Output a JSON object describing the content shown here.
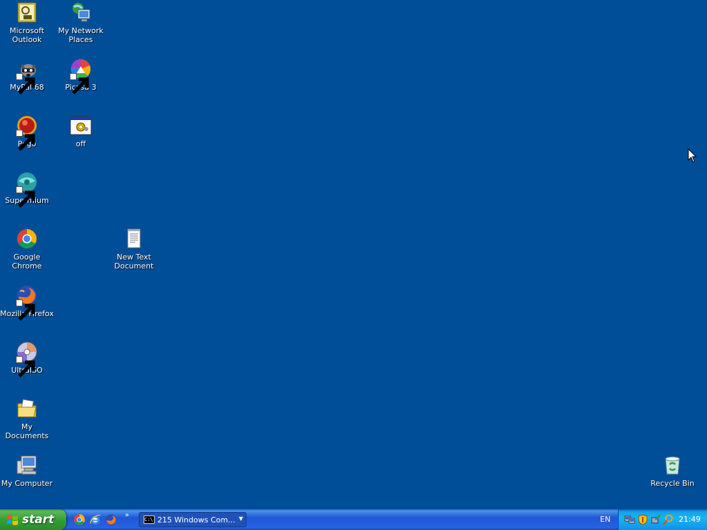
{
  "desktop": {
    "background_color": "#004e98",
    "icons": [
      {
        "label": "Microsoft\nOutlook",
        "icon": "outlook-icon"
      },
      {
        "label": "My Network\nPlaces",
        "icon": "network-places-icon"
      },
      {
        "label": "MyPal 68",
        "icon": "mypal-icon"
      },
      {
        "label": "Picasa 3",
        "icon": "picasa-icon"
      },
      {
        "label": "Pego",
        "icon": "pego-icon"
      },
      {
        "label": "off",
        "icon": "batch-file-icon"
      },
      {
        "label": "Supermium",
        "icon": "supermium-icon"
      },
      {
        "label": "Google Chrome",
        "icon": "chrome-icon"
      },
      {
        "label": "New Text\nDocument",
        "icon": "text-document-icon"
      },
      {
        "label": "Mozilla Firefox",
        "icon": "firefox-icon"
      },
      {
        "label": "UltraISO",
        "icon": "ultraiso-icon"
      },
      {
        "label": "My Documents",
        "icon": "my-documents-icon"
      },
      {
        "label": "My Computer",
        "icon": "my-computer-icon"
      },
      {
        "label": "Recycle Bin",
        "icon": "recycle-bin-icon"
      }
    ]
  },
  "taskbar": {
    "start_label": "start",
    "quick_launch": [
      "chrome-icon",
      "internet-explorer-icon",
      "firefox-icon"
    ],
    "more_chevron": "»",
    "task_button": {
      "label": "215 Windows Com...",
      "icon": "command-prompt-icon",
      "icon_text": "C:\\"
    },
    "language": "EN",
    "tray_icons": [
      "network-icon",
      "security-shield-icon",
      "safely-remove-icon",
      "search-icon"
    ],
    "clock": "21:49"
  }
}
